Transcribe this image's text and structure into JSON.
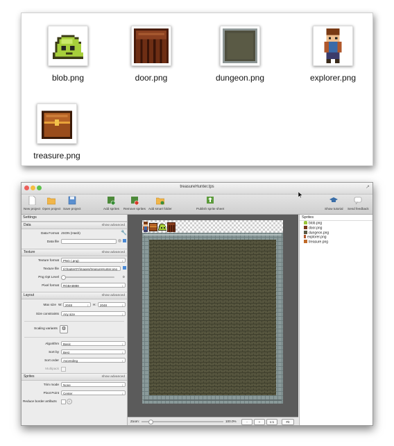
{
  "finder": {
    "files": [
      {
        "name": "blob.png",
        "icon": "blob-sprite-icon"
      },
      {
        "name": "door.png",
        "icon": "door-sprite-icon"
      },
      {
        "name": "dungeon.png",
        "icon": "dungeon-sprite-icon"
      },
      {
        "name": "explorer.png",
        "icon": "explorer-sprite-icon"
      },
      {
        "name": "treasure.png",
        "icon": "treasure-sprite-icon"
      }
    ]
  },
  "window": {
    "title": "treasureHunter.tps",
    "toolbar": {
      "new_project": "New project",
      "open_project": "Open project",
      "save_project": "Save project",
      "add_sprites": "Add sprites",
      "remove_sprites": "Remove sprites",
      "add_smart_folder": "Add smart folder",
      "publish": "Publish sprite sheet",
      "show_tutorial": "Show tutorial",
      "send_feedback": "Send feedback"
    },
    "settings": {
      "header": "Settings",
      "data_section": "Data",
      "texture_section": "Texture",
      "layout_section": "Layout",
      "sprites_section": "Sprites",
      "show_advanced": "show advanced",
      "data_format_label": "Data Format",
      "data_format_value": "JSON (Hash)",
      "data_file_label": "Data file",
      "data_file_value": "",
      "texture_format_label": "Texture format",
      "texture_format_value": "PNG (.png)",
      "texture_file_label": "Texture file",
      "texture_file_value": "t/chapter07/images/treasureHunter.png",
      "png_opt_label": "Png Opt Level",
      "png_opt_value": "0",
      "pixel_format_label": "Pixel format",
      "pixel_format_value": "RGBA8888",
      "max_size_label": "Max size",
      "w_label": "W:",
      "w_value": "2048",
      "h_label": "H:",
      "h_value": "2048",
      "size_constraints_label": "Size constraints",
      "size_constraints_value": "Any size",
      "scaling_variants_label": "Scaling variants",
      "algorithm_label": "Algorithm",
      "algorithm_value": "Basic",
      "sort_by_label": "Sort by",
      "sort_by_value": "Best",
      "sort_order_label": "Sort order",
      "sort_order_value": "Ascending",
      "multipack_label": "Multipack",
      "trim_mode_label": "Trim mode",
      "trim_mode_value": "None",
      "pivot_point_label": "Pivot Point",
      "pivot_point_value": "Center",
      "reduce_border_label": "Reduce border artifacts"
    },
    "zoom": {
      "label": "Zoom:",
      "value": "100.0%",
      "minus": "-",
      "plus": "+",
      "one_to_one": "1:1",
      "fit": "Fit"
    },
    "sprites_panel": {
      "header": "Sprites",
      "items": [
        {
          "name": "blob.png",
          "color": "#9ac43a"
        },
        {
          "name": "door.png",
          "color": "#7a3a1e"
        },
        {
          "name": "dungeon.png",
          "color": "#5b5a45"
        },
        {
          "name": "explorer.png",
          "color": "#b0572b"
        },
        {
          "name": "treasure.png",
          "color": "#c06a28"
        }
      ]
    }
  },
  "colors": {
    "accent": "#4a8ad6",
    "brick": "#56553e",
    "wall": "#8a9a9a"
  }
}
